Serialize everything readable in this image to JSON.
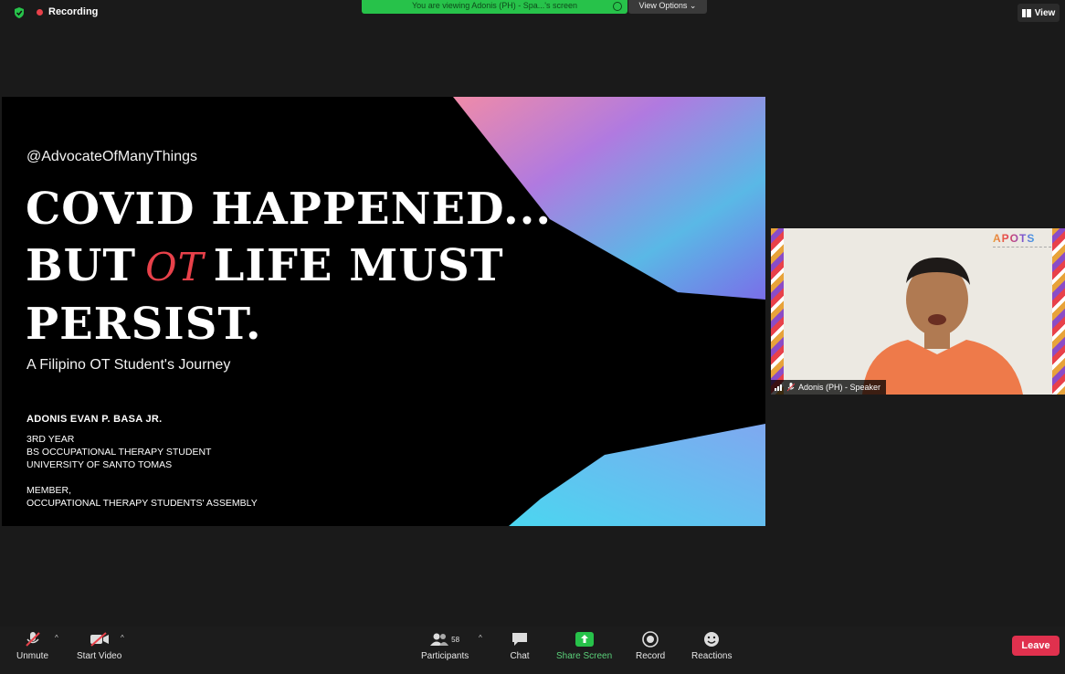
{
  "meeting": {
    "recording_label": "Recording",
    "share_banner": "You are viewing Adonis (PH) - Spa...'s screen",
    "view_options_label": "View Options",
    "view_label": "View"
  },
  "slide": {
    "handle": "@AdvocateOfManyThings",
    "title_line1": "COVID HAPPENED...",
    "title_line2_a": "BUT",
    "title_line2_ot": "OT",
    "title_line2_b": "LIFE MUST",
    "title_line3": "PERSIST.",
    "subtitle": "A Filipino OT Student's Journey",
    "author": "ADONIS EVAN P. BASA JR.",
    "info_block1": [
      "3RD YEAR",
      "BS OCCUPATIONAL THERAPY STUDENT",
      "UNIVERSITY OF SANTO TOMAS"
    ],
    "info_block2": [
      "MEMBER,",
      "OCCUPATIONAL THERAPY STUDENTS' ASSEMBLY"
    ]
  },
  "video": {
    "logo_text": "APOTS",
    "speaker_label": "Adonis (PH) - Speaker"
  },
  "toolbar": {
    "unmute": "Unmute",
    "start_video": "Start Video",
    "participants": "Participants",
    "participant_count": "58",
    "chat": "Chat",
    "share_screen": "Share Screen",
    "record": "Record",
    "reactions": "Reactions",
    "leave": "Leave"
  },
  "colors": {
    "share_green": "#27c24a",
    "leave_red": "#e0314e",
    "ot_red": "#e8414a"
  }
}
